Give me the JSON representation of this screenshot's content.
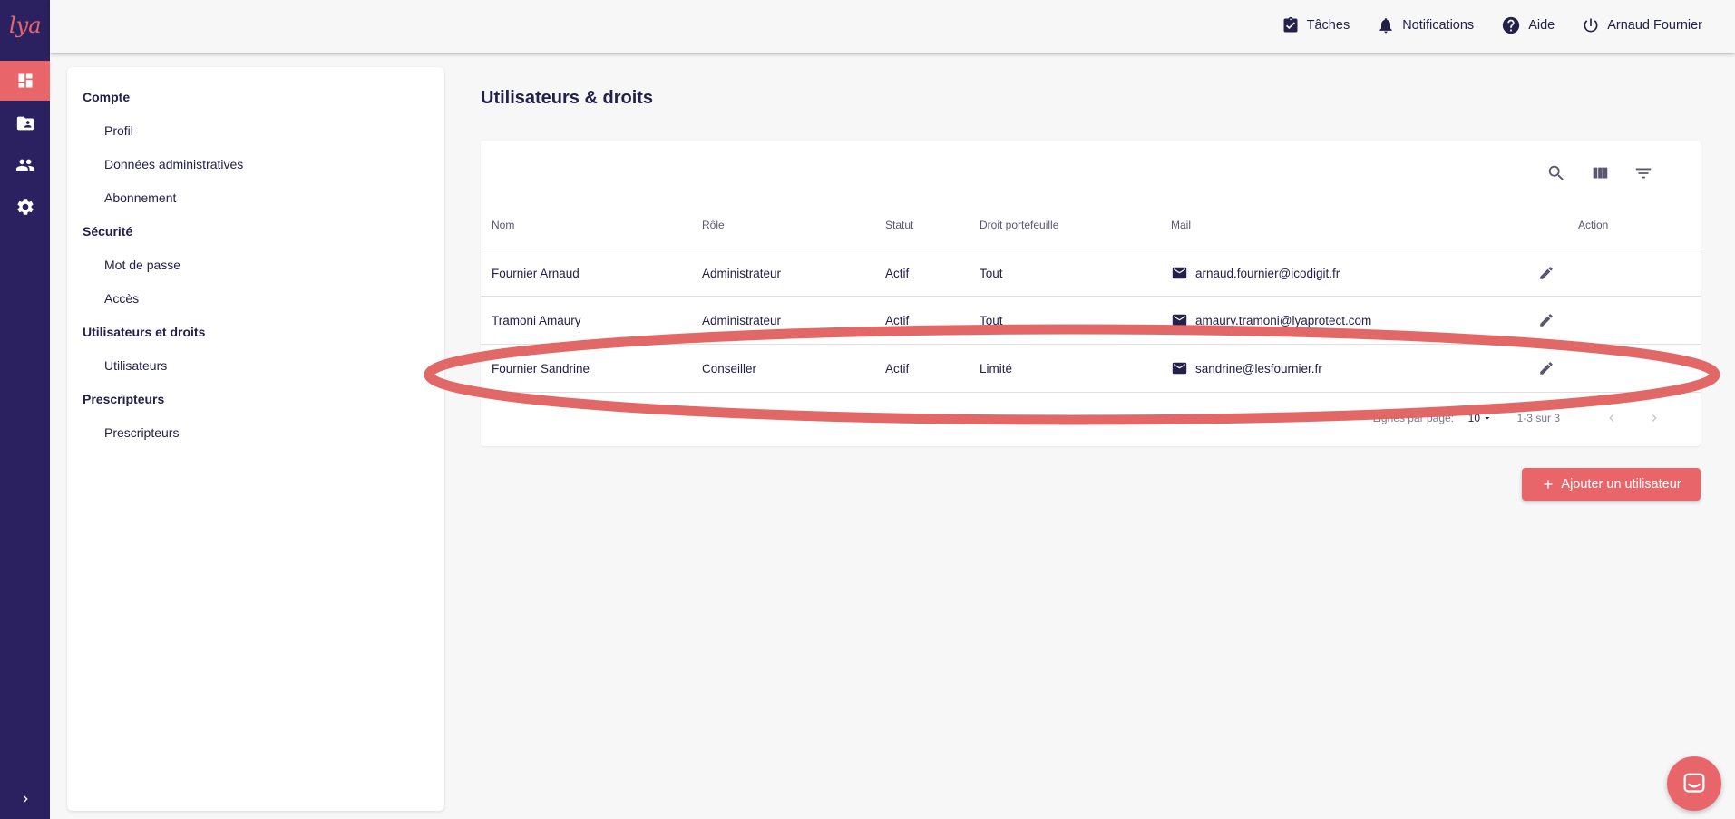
{
  "app": {
    "logo_text": "lya",
    "brand_color": "#e8666a",
    "rail_color": "#2b2161"
  },
  "rail": {
    "items": [
      {
        "name": "dashboard-icon",
        "active": true
      },
      {
        "name": "folder-account-icon",
        "active": false
      },
      {
        "name": "users-icon",
        "active": false
      },
      {
        "name": "gear-icon",
        "active": false
      }
    ],
    "expand_icon": "chevron-right-icon"
  },
  "topbar": {
    "tasks_label": "Tâches",
    "notifications_label": "Notifications",
    "help_label": "Aide",
    "user_label": "Arnaud Fournier"
  },
  "menu": {
    "sections": [
      {
        "title": "Compte",
        "items": [
          "Profil",
          "Données administratives",
          "Abonnement"
        ]
      },
      {
        "title": "Sécurité",
        "items": [
          "Mot de passe",
          "Accès"
        ]
      },
      {
        "title": "Utilisateurs et droits",
        "items": [
          "Utilisateurs"
        ]
      },
      {
        "title": "Prescripteurs",
        "items": [
          "Prescripteurs"
        ]
      }
    ]
  },
  "main": {
    "title": "Utilisateurs & droits",
    "table": {
      "tools": [
        "search-icon",
        "columns-icon",
        "filter-icon"
      ],
      "columns": [
        "Nom",
        "Rôle",
        "Statut",
        "Droit portefeuille",
        "Mail",
        "Action"
      ],
      "rows": [
        {
          "nom": "Fournier Arnaud",
          "role": "Administrateur",
          "statut": "Actif",
          "droit": "Tout",
          "mail": "arnaud.fournier@icodigit.fr"
        },
        {
          "nom": "Tramoni Amaury",
          "role": "Administrateur",
          "statut": "Actif",
          "droit": "Tout",
          "mail": "amaury.tramoni@lyaprotect.com"
        },
        {
          "nom": "Fournier Sandrine",
          "role": "Conseiller",
          "statut": "Actif",
          "droit": "Limité",
          "mail": "sandrine@lesfournier.fr"
        }
      ],
      "pagination": {
        "rows_per_page_label": "Lignes par page:",
        "rows_per_page_value": "10",
        "range_text": "1-3 sur 3"
      }
    },
    "add_button_label": "Ajouter un utilisateur"
  },
  "annotation": {
    "color": "#e06060",
    "highlighted_row": "Fournier Sandrine"
  }
}
